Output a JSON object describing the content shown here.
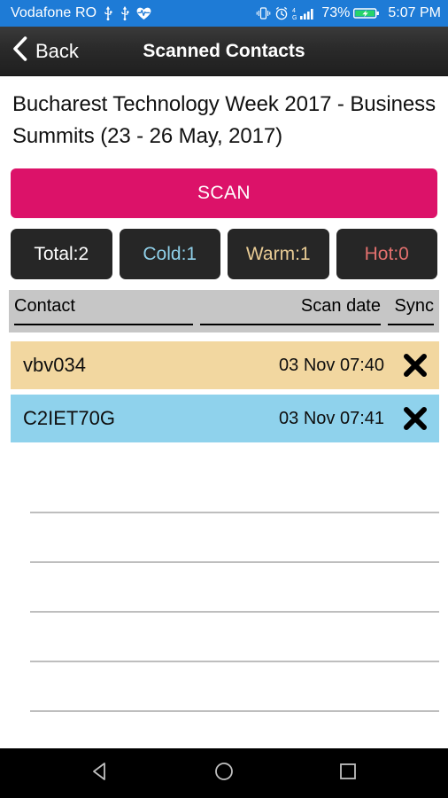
{
  "status_bar": {
    "carrier": "Vodafone RO",
    "icons": [
      "usb-icon",
      "usb-icon",
      "heart-rate-icon"
    ],
    "right_icons": [
      "vibrate-icon",
      "alarm-clock-icon",
      "signal-4g-icon"
    ],
    "network_label": "4G",
    "battery_percent": "73%",
    "battery_state": "charging",
    "clock": "5:07 PM",
    "background_color": "#1E7BD6"
  },
  "header": {
    "back_label": "Back",
    "title": "Scanned Contacts"
  },
  "main": {
    "event_title": "Bucharest Technology Week 2017 - Business Summits (23  - 26 May, 2017)",
    "scan_label": "SCAN",
    "scan_color": "#DC1269",
    "stats": [
      {
        "label": "Total:2",
        "color": "#FFFFFF"
      },
      {
        "label": "Cold:1",
        "color": "#8FCFE8"
      },
      {
        "label": "Warm:1",
        "color": "#E8CB94"
      },
      {
        "label": "Hot:0",
        "color": "#E2706E"
      }
    ],
    "table": {
      "columns": {
        "contact": "Contact",
        "scan_date": "Scan date",
        "sync": "Sync"
      },
      "rows": [
        {
          "contact": "vbv034",
          "scan_date": "03 Nov 07:40",
          "temperature": "warm",
          "row_color": "#F2D7A0"
        },
        {
          "contact": "C2IET70G",
          "scan_date": "03 Nov 07:41",
          "temperature": "cold",
          "row_color": "#8FD2EC"
        }
      ],
      "empty_row_count": 5
    }
  },
  "nav_bar": {
    "back": "back-triangle-icon",
    "home": "home-circle-icon",
    "recents": "recents-square-icon"
  }
}
